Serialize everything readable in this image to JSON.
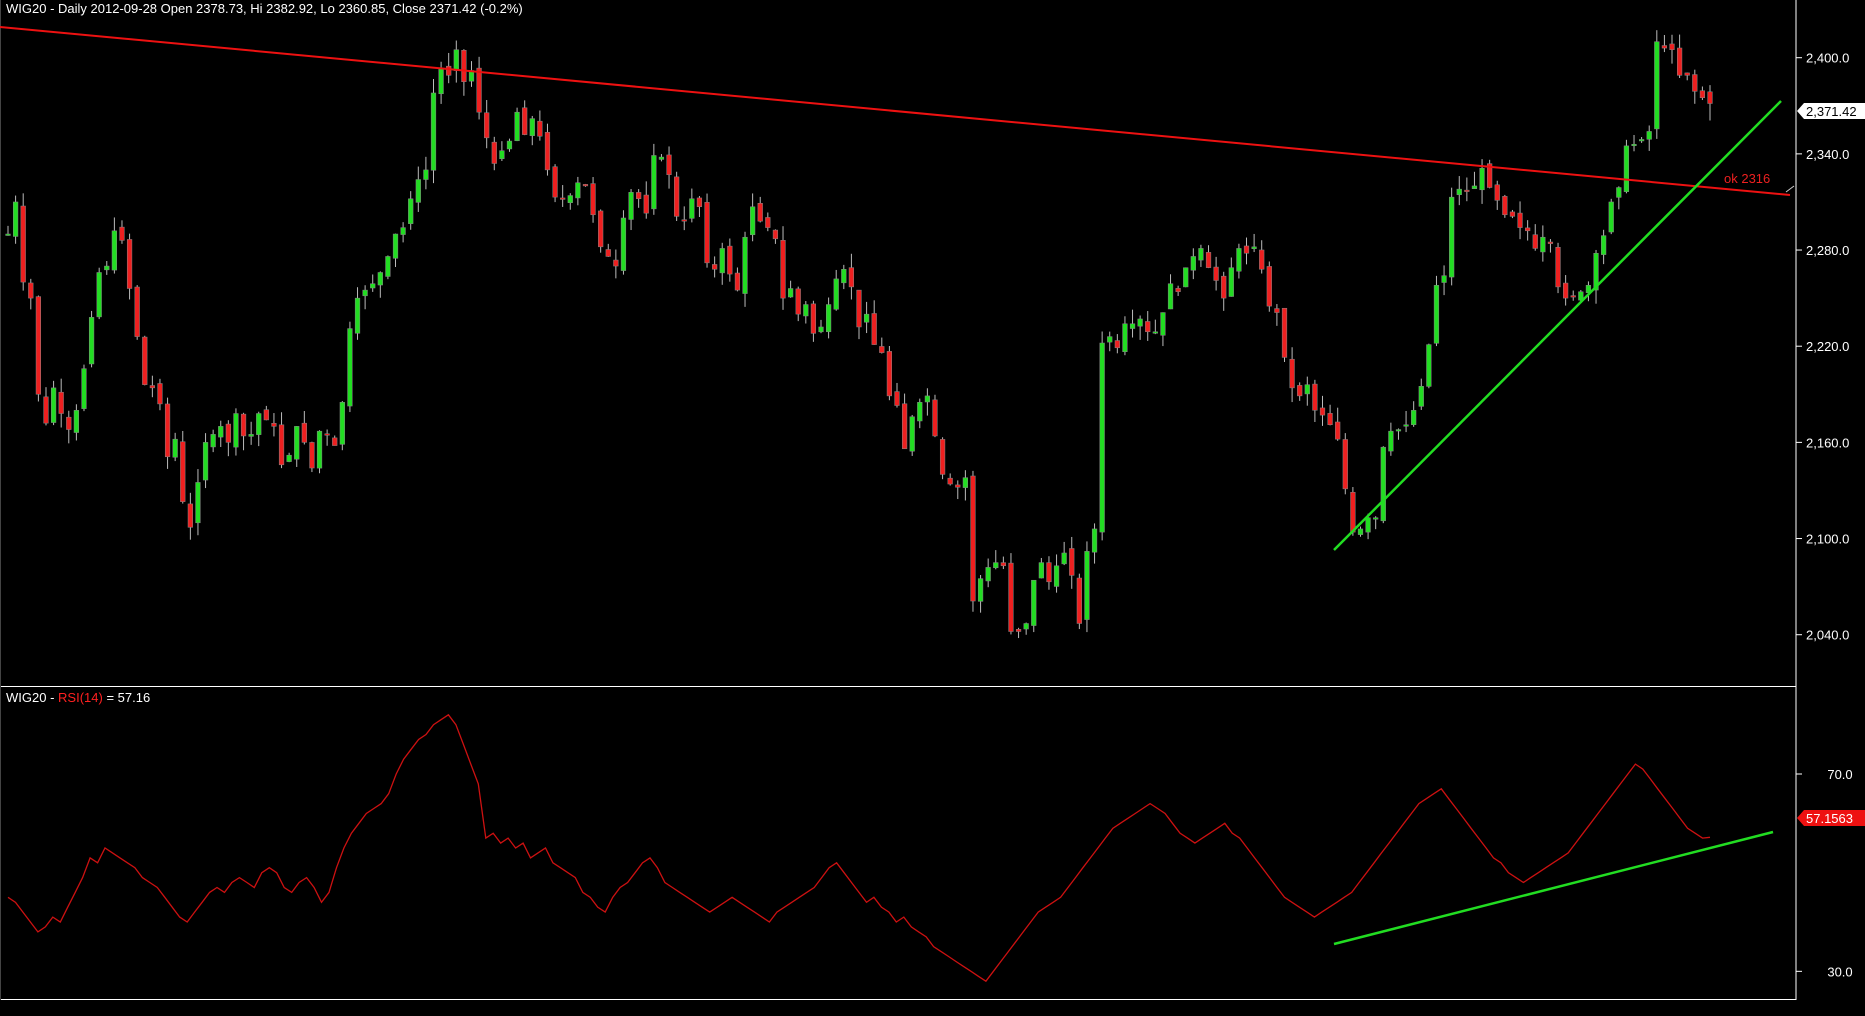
{
  "header": {
    "symbol": "WIG20",
    "price_info": "Daily 2012-09-28 Open 2378.73, Hi 2382.92, Lo 2360.85, Close 2371.42 (-0.2%)"
  },
  "rsi_header": {
    "symbol": "WIG20",
    "separator": " - ",
    "indicator": "RSI(14)",
    "value_text": " = 57.16"
  },
  "colors": {
    "background": "#000000",
    "up_candle": "#22dd22",
    "down_candle": "#ee2020",
    "resistance_line": "#ee1111",
    "support_line": "#22dd22",
    "rsi_line": "#cc1111",
    "axis_text": "#ffffff",
    "frame": "#ffffff"
  },
  "price_axis": {
    "ticks": [
      "2,400.0",
      "2,340.0",
      "2,280.0",
      "2,220.0",
      "2,160.0",
      "2,100.0",
      "2,040.0"
    ],
    "last_price_label": "2,371.42"
  },
  "rsi_axis": {
    "ticks": [
      "70.0",
      "30.0"
    ],
    "last_value_label": "57.1563"
  },
  "annotations": {
    "resistance_label": "ok 2316"
  },
  "chart_data": [
    {
      "type": "candlestick",
      "series_name": "WIG20",
      "period": "Daily",
      "last_date": "2012-09-28",
      "y_range": [
        2008,
        2436
      ],
      "y_ticks": [
        2040,
        2100,
        2160,
        2220,
        2280,
        2340,
        2400
      ],
      "last_bar": {
        "open": 2378.73,
        "high": 2382.92,
        "low": 2360.85,
        "close": 2371.42,
        "change_pct": -0.2
      },
      "closes_approx": [
        2290,
        2310,
        2260,
        2250,
        2190,
        2172,
        2194,
        2178,
        2168,
        2180,
        2206,
        2238,
        2266,
        2270,
        2292,
        2286,
        2256,
        2226,
        2196,
        2194,
        2184,
        2151,
        2162,
        2123,
        2107,
        2135,
        2160,
        2165,
        2170,
        2160,
        2178,
        2164,
        2165,
        2178,
        2174,
        2170,
        2146,
        2152,
        2170,
        2160,
        2144,
        2167,
        2165,
        2158,
        2185,
        2231,
        2250,
        2255,
        2259,
        2266,
        2276,
        2290,
        2294,
        2312,
        2324,
        2330,
        2378,
        2393,
        2389,
        2405,
        2385,
        2392,
        2366,
        2350,
        2334,
        2342,
        2348,
        2366,
        2352,
        2362,
        2351,
        2330,
        2313,
        2312,
        2314,
        2322,
        2320,
        2302,
        2282,
        2276,
        2270,
        2300,
        2316,
        2312,
        2303,
        2339,
        2338,
        2327,
        2301,
        2298,
        2312,
        2307,
        2272,
        2268,
        2281,
        2265,
        2255,
        2288,
        2307,
        2298,
        2294,
        2287,
        2250,
        2256,
        2240,
        2246,
        2228,
        2232,
        2246,
        2262,
        2268,
        2257,
        2232,
        2240,
        2221,
        2216,
        2189,
        2183,
        2156,
        2176,
        2185,
        2189,
        2164,
        2140,
        2134,
        2132,
        2138,
        2061,
        2075,
        2082,
        2085,
        2083,
        2042,
        2042,
        2047,
        2074,
        2085,
        2073,
        2083,
        2091,
        2077,
        2047,
        2092,
        2106,
        2222,
        2226,
        2219,
        2234,
        2234,
        2237,
        2229,
        2229,
        2241,
        2259,
        2254,
        2269,
        2276,
        2281,
        2269,
        2261,
        2250,
        2269,
        2281,
        2278,
        2282,
        2268,
        2245,
        2241,
        2213,
        2194,
        2189,
        2196,
        2180,
        2177,
        2171,
        2162,
        2131,
        2104,
        2106,
        2113,
        2113,
        2157,
        2167,
        2168,
        2171,
        2180,
        2195,
        2221,
        2258,
        2264,
        2313,
        2318,
        2317,
        2320,
        2331,
        2319,
        2311,
        2302,
        2301,
        2294,
        2292,
        2281,
        2288,
        2284,
        2257,
        2250,
        2251,
        2254,
        2258,
        2278,
        2289,
        2310,
        2319,
        2345,
        2346,
        2349,
        2354,
        2410,
        2406,
        2405,
        2389,
        2389,
        2379,
        2375,
        2371
      ]
    },
    {
      "type": "line",
      "series_name": "RSI(14)",
      "last_value": 57.16,
      "y_range": [
        25,
        85
      ],
      "y_ticks": [
        30,
        70
      ],
      "values_approx": [
        45,
        44,
        42,
        40,
        38,
        39,
        41,
        40,
        43,
        46,
        49,
        53,
        52,
        55,
        54,
        53,
        52,
        51,
        49,
        48,
        47,
        45,
        43,
        41,
        40,
        42,
        44,
        46,
        47,
        46,
        48,
        49,
        48,
        47,
        50,
        51,
        50,
        47,
        46,
        48,
        49,
        47,
        44,
        46,
        51,
        55,
        58,
        60,
        62,
        63,
        64,
        66,
        70,
        73,
        75,
        77,
        78,
        80,
        81,
        82,
        80,
        76,
        72,
        68,
        57,
        58,
        56,
        57,
        55,
        56,
        53,
        54,
        55,
        52,
        51,
        50,
        49,
        46,
        45,
        43,
        42,
        45,
        47,
        48,
        50,
        52,
        53,
        51,
        48,
        47,
        46,
        45,
        44,
        43,
        42,
        43,
        44,
        45,
        44,
        43,
        42,
        41,
        40,
        42,
        43,
        44,
        45,
        46,
        47,
        49,
        51,
        52,
        50,
        48,
        46,
        44,
        45,
        43,
        42,
        40,
        41,
        39,
        38,
        37,
        35,
        34,
        33,
        32,
        31,
        30,
        29,
        28,
        30,
        32,
        34,
        36,
        38,
        40,
        42,
        43,
        44,
        45,
        47,
        49,
        51,
        53,
        55,
        57,
        59,
        60,
        61,
        62,
        63,
        64,
        63,
        62,
        60,
        58,
        57,
        56,
        57,
        58,
        59,
        60,
        58,
        57,
        55,
        53,
        51,
        49,
        47,
        45,
        44,
        43,
        42,
        41,
        42,
        43,
        44,
        45,
        46,
        48,
        50,
        52,
        54,
        56,
        58,
        60,
        62,
        64,
        65,
        66,
        67,
        65,
        63,
        61,
        59,
        57,
        55,
        53,
        52,
        50,
        49,
        48,
        49,
        50,
        51,
        52,
        53,
        54,
        56,
        58,
        60,
        62,
        64,
        66,
        68,
        70,
        72,
        71,
        69,
        67,
        65,
        63,
        61,
        59,
        58,
        57,
        57
      ]
    }
  ]
}
